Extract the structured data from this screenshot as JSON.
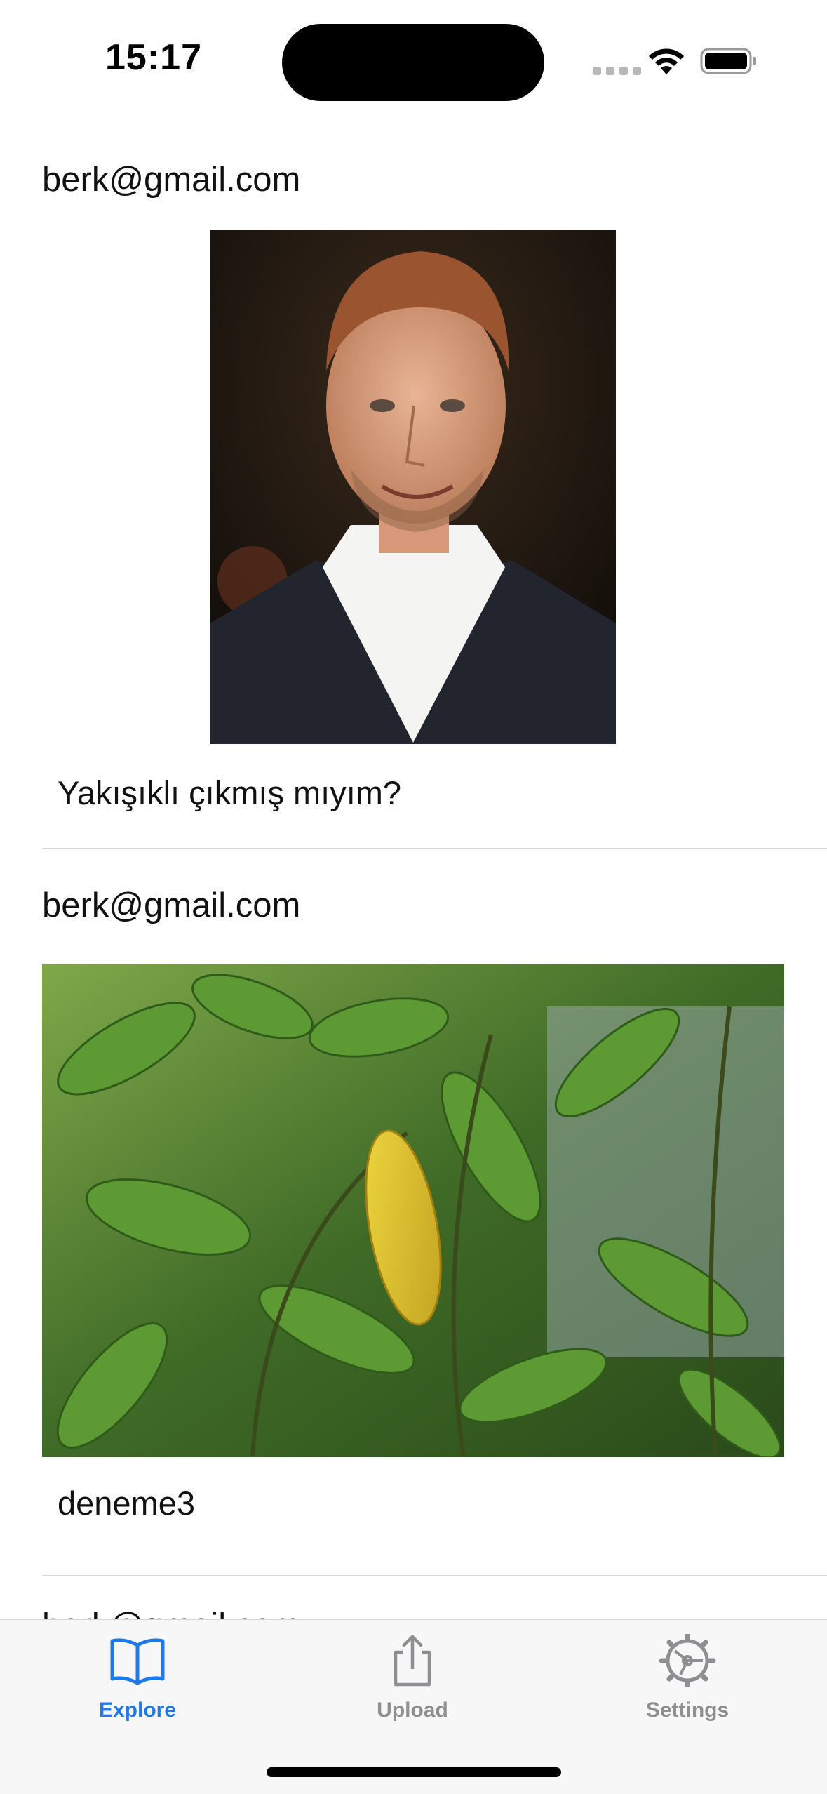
{
  "status_bar": {
    "time": "15:17"
  },
  "feed": {
    "posts": [
      {
        "email": "berk@gmail.com",
        "image": "portrait-photo",
        "caption": "Yakışıklı çıkmış mıyım?"
      },
      {
        "email": "berk@gmail.com",
        "image": "plant-leaves-photo",
        "caption": "deneme3"
      },
      {
        "email": "berk@gmail.com",
        "image": "",
        "caption": ""
      }
    ]
  },
  "tab_bar": {
    "tabs": [
      {
        "label": "Explore",
        "icon": "book-icon",
        "active": true
      },
      {
        "label": "Upload",
        "icon": "share-upload-icon",
        "active": false
      },
      {
        "label": "Settings",
        "icon": "gear-icon",
        "active": false
      }
    ],
    "colors": {
      "active": "#1f7ae8",
      "inactive": "#8e8e93"
    }
  }
}
